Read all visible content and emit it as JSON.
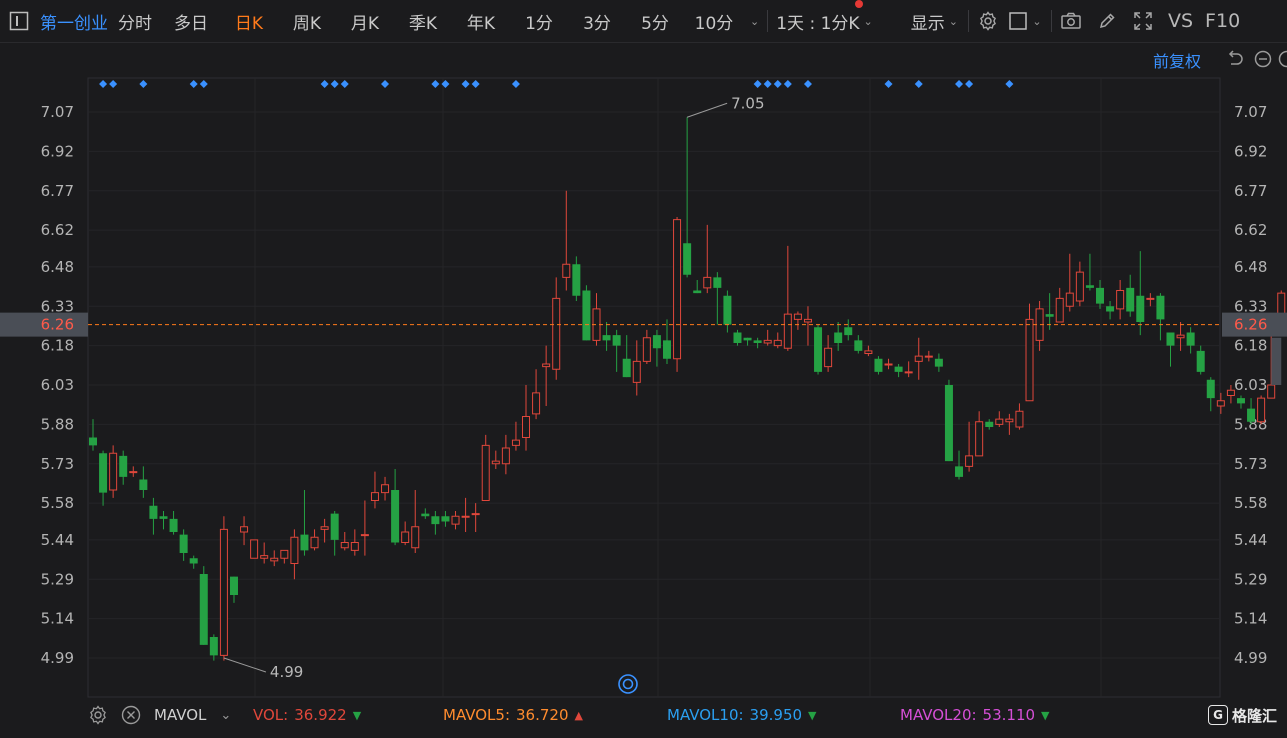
{
  "toolbar": {
    "stock_name": "第一创业",
    "tabs": [
      {
        "label": "分时",
        "active": false
      },
      {
        "label": "多日",
        "active": false
      },
      {
        "label": "日K",
        "active": true
      },
      {
        "label": "周K",
        "active": false
      },
      {
        "label": "月K",
        "active": false
      },
      {
        "label": "季K",
        "active": false
      },
      {
        "label": "年K",
        "active": false
      },
      {
        "label": "1分",
        "active": false
      },
      {
        "label": "3分",
        "active": false
      },
      {
        "label": "5分",
        "active": false
      },
      {
        "label": "10分",
        "active": false
      }
    ],
    "interval_selector": "1天 : 1分K",
    "display_menu": "显示",
    "vs_label": "VS",
    "f10_label": "F10"
  },
  "subbar": {
    "adjust_label": "前复权"
  },
  "price_axis": {
    "ticks": [
      "7.07",
      "6.92",
      "6.77",
      "6.62",
      "6.48",
      "6.33",
      "6.18",
      "6.03",
      "5.88",
      "5.73",
      "5.58",
      "5.44",
      "5.29",
      "5.14",
      "4.99"
    ],
    "current_price": "6.26"
  },
  "annotations": {
    "high_label": "7.05",
    "low_label": "4.99"
  },
  "indicator": {
    "name": "MAVOL",
    "vol_label": "VOL:",
    "vol_value": "36.922",
    "vol_trend": "down",
    "mavol5_label": "MAVOL5:",
    "mavol5_value": "36.720",
    "mavol5_trend": "up",
    "mavol10_label": "MAVOL10:",
    "mavol10_value": "39.950",
    "mavol10_trend": "down",
    "mavol20_label": "MAVOL20:",
    "mavol20_value": "53.110",
    "mavol20_trend": "down"
  },
  "watermark": "格隆汇",
  "colors": {
    "background": "#1b1b1d",
    "up": "#e0473b",
    "down": "#25a244",
    "accent": "#ff7a1a",
    "link": "#3a91ff",
    "vol": "#e0473b",
    "mavol5": "#ff8c2e",
    "mavol10": "#2b9ff0",
    "mavol20": "#d54fd6"
  },
  "chart_data": {
    "type": "candlestick",
    "y_range": [
      4.92,
      7.12
    ],
    "candles": [
      [
        5.83,
        5.8,
        5.9,
        5.78
      ],
      [
        5.77,
        5.62,
        5.78,
        5.57
      ],
      [
        5.63,
        5.77,
        5.8,
        5.6
      ],
      [
        5.76,
        5.68,
        5.78,
        5.65
      ],
      [
        5.7,
        5.7,
        5.72,
        5.68
      ],
      [
        5.67,
        5.63,
        5.72,
        5.6
      ],
      [
        5.57,
        5.52,
        5.6,
        5.46
      ],
      [
        5.53,
        5.52,
        5.55,
        5.48
      ],
      [
        5.52,
        5.47,
        5.55,
        5.46
      ],
      [
        5.46,
        5.39,
        5.48,
        5.36
      ],
      [
        5.37,
        5.35,
        5.38,
        5.33
      ],
      [
        5.31,
        5.04,
        5.34,
        5.04
      ],
      [
        5.07,
        5.0,
        5.08,
        4.98
      ],
      [
        5.0,
        5.48,
        5.53,
        4.98
      ],
      [
        5.3,
        5.23,
        5.3,
        5.2
      ],
      [
        5.47,
        5.49,
        5.53,
        5.42
      ],
      [
        5.37,
        5.44,
        5.44,
        5.37
      ],
      [
        5.37,
        5.38,
        5.43,
        5.35
      ],
      [
        5.36,
        5.37,
        5.4,
        5.34
      ],
      [
        5.37,
        5.4,
        5.4,
        5.35
      ],
      [
        5.35,
        5.45,
        5.48,
        5.29
      ],
      [
        5.46,
        5.4,
        5.63,
        5.38
      ],
      [
        5.41,
        5.45,
        5.48,
        5.4
      ],
      [
        5.48,
        5.49,
        5.52,
        5.43
      ],
      [
        5.54,
        5.44,
        5.55,
        5.38
      ],
      [
        5.41,
        5.43,
        5.47,
        5.4
      ],
      [
        5.4,
        5.43,
        5.48,
        5.38
      ],
      [
        5.46,
        5.46,
        5.59,
        5.38
      ],
      [
        5.59,
        5.62,
        5.7,
        5.56
      ],
      [
        5.62,
        5.65,
        5.68,
        5.59
      ],
      [
        5.63,
        5.43,
        5.71,
        5.42
      ],
      [
        5.43,
        5.47,
        5.51,
        5.42
      ],
      [
        5.41,
        5.49,
        5.63,
        5.39
      ],
      [
        5.54,
        5.53,
        5.56,
        5.52
      ],
      [
        5.53,
        5.5,
        5.55,
        5.46
      ],
      [
        5.53,
        5.51,
        5.55,
        5.49
      ],
      [
        5.5,
        5.53,
        5.55,
        5.48
      ],
      [
        5.53,
        5.53,
        5.6,
        5.47
      ],
      [
        5.54,
        5.54,
        5.58,
        5.47
      ],
      [
        5.59,
        5.8,
        5.84,
        5.59
      ],
      [
        5.73,
        5.74,
        5.78,
        5.71
      ],
      [
        5.73,
        5.79,
        5.84,
        5.69
      ],
      [
        5.8,
        5.82,
        5.89,
        5.78
      ],
      [
        5.83,
        5.91,
        6.03,
        5.78
      ],
      [
        5.92,
        6.0,
        6.09,
        5.9
      ],
      [
        6.1,
        6.11,
        6.18,
        5.95
      ],
      [
        6.09,
        6.36,
        6.44,
        6.05
      ],
      [
        6.44,
        6.49,
        6.77,
        6.39
      ],
      [
        6.49,
        6.37,
        6.52,
        6.35
      ],
      [
        6.39,
        6.2,
        6.41,
        6.2
      ],
      [
        6.2,
        6.32,
        6.38,
        6.18
      ],
      [
        6.22,
        6.2,
        6.27,
        6.16
      ],
      [
        6.22,
        6.18,
        6.24,
        6.08
      ],
      [
        6.13,
        6.06,
        6.22,
        6.06
      ],
      [
        6.04,
        6.12,
        6.2,
        5.99
      ],
      [
        6.12,
        6.21,
        6.24,
        6.11
      ],
      [
        6.22,
        6.17,
        6.24,
        6.1
      ],
      [
        6.2,
        6.13,
        6.28,
        6.11
      ],
      [
        6.13,
        6.66,
        6.67,
        6.08
      ],
      [
        6.57,
        6.45,
        7.05,
        6.44
      ],
      [
        6.39,
        6.38,
        6.43,
        6.38
      ],
      [
        6.4,
        6.44,
        6.64,
        6.38
      ],
      [
        6.44,
        6.4,
        6.46,
        6.26
      ],
      [
        6.37,
        6.26,
        6.39,
        6.23
      ],
      [
        6.23,
        6.19,
        6.24,
        6.18
      ],
      [
        6.21,
        6.2,
        6.21,
        6.18
      ],
      [
        6.2,
        6.19,
        6.21,
        6.17
      ],
      [
        6.19,
        6.2,
        6.24,
        6.18
      ],
      [
        6.18,
        6.2,
        6.23,
        6.17
      ],
      [
        6.17,
        6.3,
        6.56,
        6.16
      ],
      [
        6.28,
        6.3,
        6.31,
        6.24
      ],
      [
        6.27,
        6.28,
        6.33,
        6.18
      ],
      [
        6.25,
        6.08,
        6.26,
        6.07
      ],
      [
        6.1,
        6.17,
        6.22,
        6.08
      ],
      [
        6.23,
        6.19,
        6.27,
        6.16
      ],
      [
        6.25,
        6.22,
        6.28,
        6.2
      ],
      [
        6.2,
        6.16,
        6.22,
        6.15
      ],
      [
        6.15,
        6.16,
        6.18,
        6.14
      ],
      [
        6.13,
        6.08,
        6.14,
        6.07
      ],
      [
        6.11,
        6.11,
        6.13,
        6.09
      ],
      [
        6.1,
        6.08,
        6.11,
        6.06
      ],
      [
        6.08,
        6.08,
        6.12,
        6.06
      ],
      [
        6.12,
        6.14,
        6.21,
        6.05
      ],
      [
        6.14,
        6.14,
        6.16,
        6.12
      ],
      [
        6.13,
        6.1,
        6.15,
        6.08
      ],
      [
        6.03,
        5.74,
        6.05,
        5.74
      ],
      [
        5.72,
        5.68,
        5.78,
        5.67
      ],
      [
        5.72,
        5.76,
        5.89,
        5.7
      ],
      [
        5.76,
        5.89,
        5.93,
        5.76
      ],
      [
        5.89,
        5.87,
        5.9,
        5.86
      ],
      [
        5.88,
        5.9,
        5.93,
        5.87
      ],
      [
        5.89,
        5.9,
        5.92,
        5.84
      ],
      [
        5.87,
        5.93,
        5.96,
        5.86
      ],
      [
        5.97,
        6.28,
        6.34,
        5.97
      ],
      [
        6.2,
        6.32,
        6.35,
        6.16
      ],
      [
        6.3,
        6.29,
        6.38,
        6.24
      ],
      [
        6.27,
        6.36,
        6.4,
        6.28
      ],
      [
        6.33,
        6.38,
        6.53,
        6.31
      ],
      [
        6.35,
        6.46,
        6.5,
        6.33
      ],
      [
        6.41,
        6.4,
        6.53,
        6.39
      ],
      [
        6.4,
        6.34,
        6.43,
        6.32
      ],
      [
        6.33,
        6.31,
        6.35,
        6.28
      ],
      [
        6.32,
        6.39,
        6.43,
        6.28
      ],
      [
        6.4,
        6.31,
        6.45,
        6.29
      ],
      [
        6.37,
        6.27,
        6.54,
        6.22
      ],
      [
        6.36,
        6.36,
        6.38,
        6.33
      ],
      [
        6.37,
        6.28,
        6.38,
        6.2
      ],
      [
        6.23,
        6.18,
        6.23,
        6.1
      ],
      [
        6.21,
        6.22,
        6.27,
        6.16
      ],
      [
        6.23,
        6.18,
        6.25,
        6.15
      ],
      [
        6.16,
        6.08,
        6.18,
        6.07
      ],
      [
        6.05,
        5.98,
        6.06,
        5.93
      ],
      [
        5.95,
        5.97,
        6.0,
        5.92
      ],
      [
        5.99,
        6.01,
        6.03,
        5.96
      ],
      [
        5.98,
        5.96,
        5.99,
        5.94
      ],
      [
        5.94,
        5.89,
        5.98,
        5.88
      ],
      [
        5.89,
        5.98,
        5.99,
        5.88
      ],
      [
        5.98,
        6.03,
        6.23,
        5.98
      ],
      [
        6.26,
        6.38,
        6.39,
        6.26
      ]
    ],
    "event_markers": [
      1,
      2,
      5,
      10,
      11,
      23,
      24,
      25,
      29,
      34,
      35,
      37,
      38,
      42,
      66,
      67,
      68,
      69,
      71,
      79,
      82,
      86,
      87,
      91
    ]
  }
}
